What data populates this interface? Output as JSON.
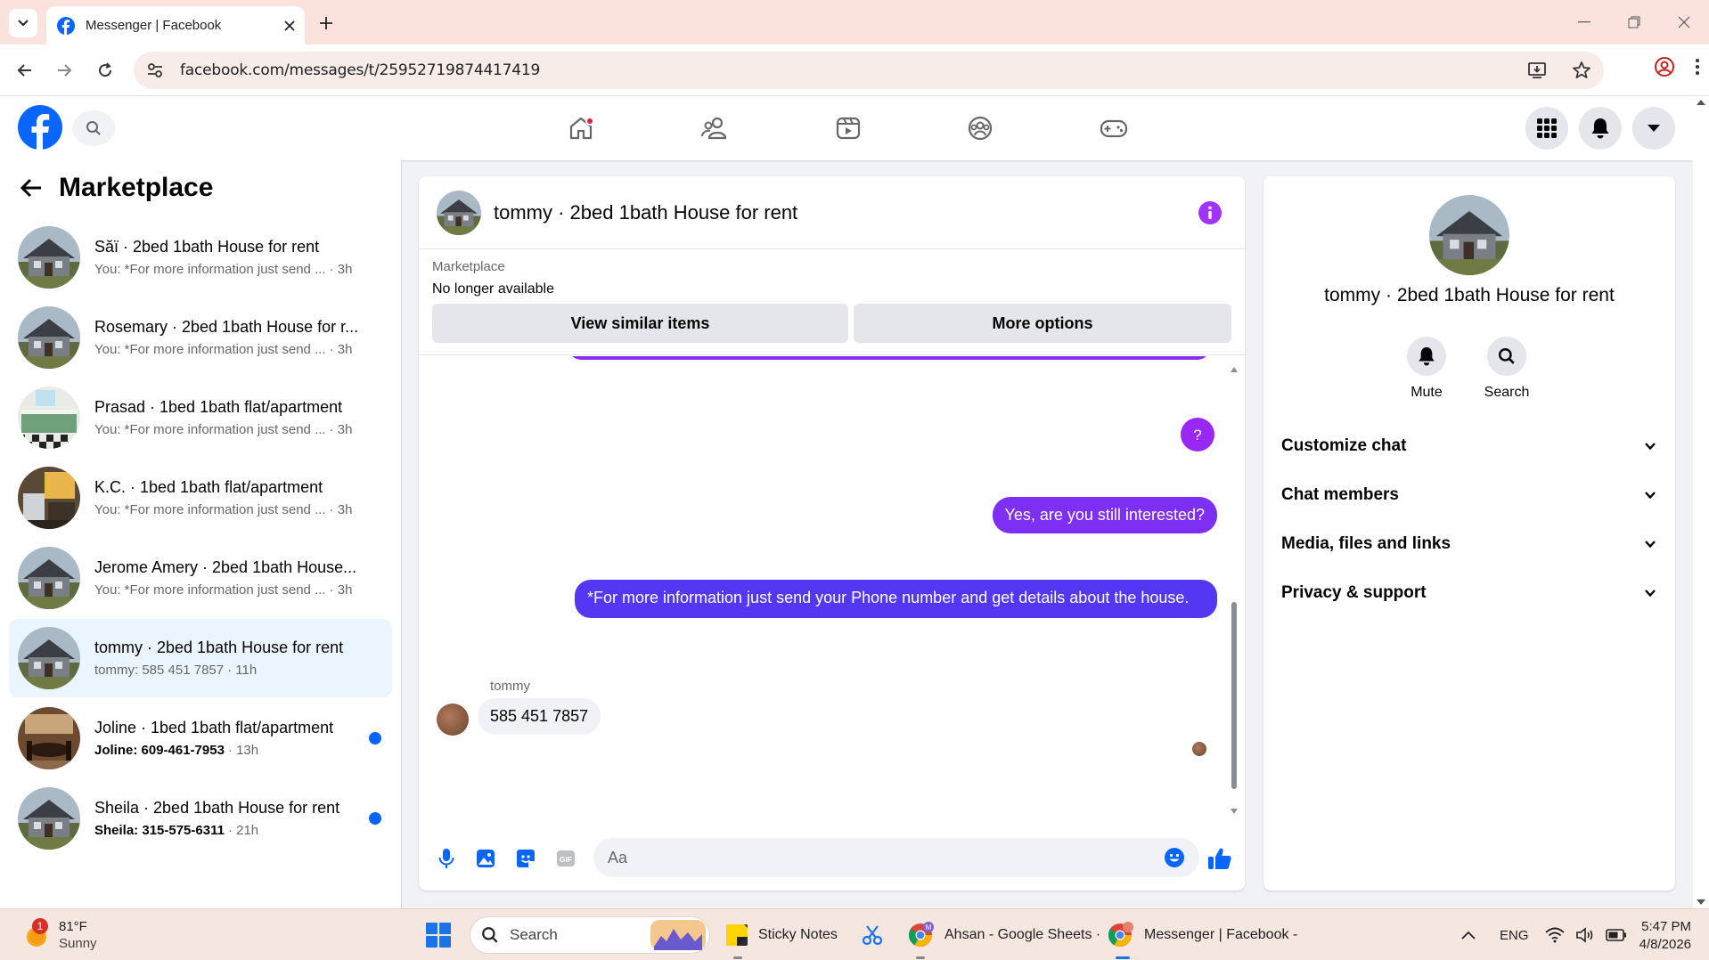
{
  "browser": {
    "tab_title": "Messenger | Facebook",
    "url": "facebook.com/messages/t/25952719874417419"
  },
  "sidebar": {
    "title": "Marketplace",
    "conversations": [
      {
        "name": "Săï · 2bed 1bath House for rent",
        "preview": "You: *For more information just send ...",
        "time": "· 3h",
        "thumb": "house"
      },
      {
        "name": "Rosemary · 2bed 1bath House for r...",
        "preview": "You: *For more information just send ...",
        "time": "· 3h",
        "thumb": "house"
      },
      {
        "name": "Prasad · 1bed 1bath flat/apartment",
        "preview": "You: *For more information just send ...",
        "time": "· 3h",
        "thumb": "kitchen"
      },
      {
        "name": "K.C. · 1bed 1bath flat/apartment",
        "preview": "You: *For more information just send ...",
        "time": "· 3h",
        "thumb": "room"
      },
      {
        "name": "Jerome Amery · 2bed 1bath House...",
        "preview": "You: *For more information just send ...",
        "time": "· 3h",
        "thumb": "house"
      },
      {
        "name": "tommy · 2bed 1bath House for rent",
        "preview": "tommy: 585 451 7857",
        "time": "· 11h",
        "thumb": "house",
        "active": true
      },
      {
        "name": "Joline · 1bed 1bath flat/apartment",
        "preview": "Joline: 609-461-7953",
        "time": "· 13h",
        "thumb": "dining",
        "unread": true
      },
      {
        "name": "Sheila · 2bed 1bath House for rent",
        "preview": "Sheila: 315-575-6311",
        "time": "· 21h",
        "thumb": "house",
        "unread": true
      }
    ]
  },
  "chat": {
    "title": "tommy · 2bed 1bath House for rent",
    "marketplace_label": "Marketplace",
    "status": "No longer available",
    "view_similar": "View similar items",
    "more_options": "More options",
    "messages": {
      "q": "?",
      "interested": "Yes, are you still interested?",
      "info": "*For more information just send your Phone number and  get details about the house.",
      "sender": "tommy",
      "reply": "585 451 7857"
    },
    "input_placeholder": "Aa"
  },
  "info_panel": {
    "name": "tommy · 2bed 1bath House for rent",
    "mute": "Mute",
    "search": "Search",
    "sections": [
      "Customize chat",
      "Chat members",
      "Media, files and links",
      "Privacy & support"
    ]
  },
  "taskbar": {
    "weather_temp": "81°F",
    "weather_desc": "Sunny",
    "weather_badge": "1",
    "search": "Search",
    "apps": [
      "Sticky Notes",
      "Ahsan - Google Sheets ·",
      "Messenger | Facebook -"
    ],
    "lang": "ENG",
    "time": "5:47 PM",
    "date": "4/8/2026"
  },
  "colors": {
    "fb_blue": "#0866ff",
    "purple": "#a033ff",
    "bubble_blue": "#5337f2",
    "chrome_tab": "#f9e3dc"
  }
}
